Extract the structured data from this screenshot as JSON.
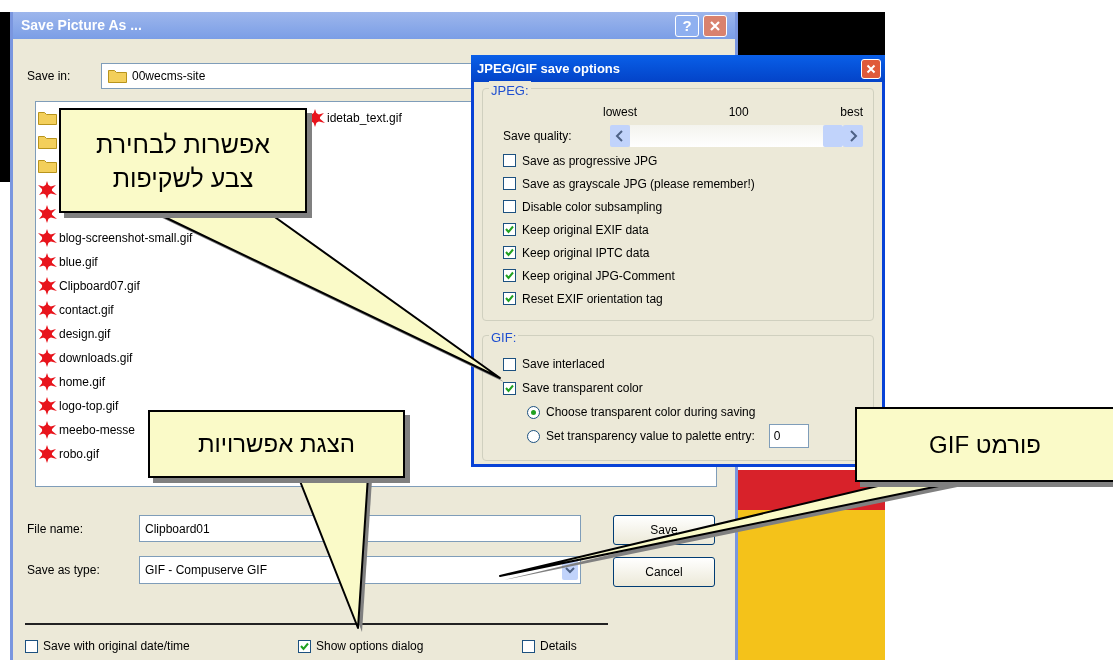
{
  "save_dialog": {
    "title": "Save Picture As ...",
    "help_button": "?",
    "save_in": {
      "label": "Save in:",
      "value": "00wecms-site"
    },
    "file_list": {
      "columns": [
        [
          {
            "kind": "folder"
          },
          {
            "kind": "folder"
          },
          {
            "kind": "folder"
          },
          {
            "kind": "gif"
          },
          {
            "kind": "gif"
          },
          {
            "kind": "gif",
            "name": "blog-screenshot-small.gif"
          },
          {
            "kind": "gif",
            "name": "blue.gif"
          },
          {
            "kind": "gif",
            "name": "Clipboard07.gif"
          },
          {
            "kind": "gif",
            "name": "contact.gif"
          },
          {
            "kind": "gif",
            "name": "design.gif"
          },
          {
            "kind": "gif",
            "name": "downloads.gif"
          },
          {
            "kind": "gif",
            "name": "home.gif"
          },
          {
            "kind": "gif",
            "name": "logo-top.gif"
          },
          {
            "kind": "gif",
            "name": "meebo-messe"
          },
          {
            "kind": "gif",
            "name": "robo.gif"
          }
        ],
        [
          {
            "kind": "gif",
            "name": "idetab_text.gif"
          }
        ]
      ]
    },
    "file_name": {
      "label": "File name:",
      "value": "Clipboard01"
    },
    "save_as_type": {
      "label": "Save as type:",
      "value": "GIF - Compuserve GIF"
    },
    "buttons": [
      "Save",
      "Cancel"
    ],
    "options": [
      {
        "label": "Save with original date/time",
        "checked": false
      },
      {
        "label": "Show options dialog",
        "checked": true
      },
      {
        "label": "Details",
        "checked": false
      }
    ]
  },
  "options_dialog": {
    "title": "JPEG/GIF save options",
    "jpeg": {
      "title": "JPEG:",
      "scale_labels": [
        "lowest",
        "100",
        "best"
      ],
      "quality_label": "Save quality:",
      "level": 1,
      "checkboxes": [
        {
          "label": "Save as progressive JPG",
          "checked": false
        },
        {
          "label": "Save as grayscale JPG (please remember!)",
          "checked": false
        },
        {
          "label": "Disable color subsampling",
          "checked": false
        },
        {
          "label": "Keep original EXIF data",
          "checked": true
        },
        {
          "label": "Keep original IPTC data",
          "checked": true
        },
        {
          "label": "Keep original JPG-Comment",
          "checked": true
        },
        {
          "label": "Reset EXIF orientation tag",
          "checked": true
        }
      ]
    },
    "gif": {
      "title": "GIF:",
      "checkboxes": [
        {
          "label": "Save interlaced",
          "checked": false
        },
        {
          "label": "Save transparent color",
          "checked": true
        }
      ],
      "radios": [
        {
          "label": "Choose transparent color during saving",
          "selected": true
        },
        {
          "label": "Set transparency value to palette entry:",
          "selected": false
        }
      ],
      "palette_entry": "0"
    }
  },
  "callouts": [
    {
      "text": "אפשרות לבחירת\nצבע לשקיפות"
    },
    {
      "text": "הצגת אפשרויות"
    },
    {
      "text": "פורמט GIF"
    }
  ]
}
